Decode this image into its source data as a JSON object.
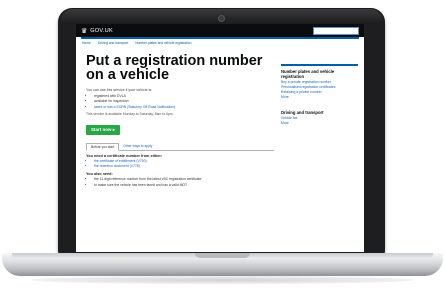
{
  "header": {
    "logo": "GOV.UK"
  },
  "breadcrumb": [
    "Home",
    "Driving and transport",
    "Number plates and vehicle registration"
  ],
  "main": {
    "title": "Put a registration number on a vehicle",
    "intro": "You can use this service if your vehicle is:",
    "bullets": [
      "registered with DVLA",
      "available for inspection",
      "taxed or has a SORN (Statutory Off Road Notification)"
    ],
    "note": "This service is available Monday to Saturday, 8am to 6pm.",
    "start_label": "Start now",
    "tabs": [
      "Before you start",
      "Other ways to apply"
    ],
    "section_heading": "You need a certificate number from either:",
    "section_links": [
      "the certificate of entitlement (V750)",
      "the retention document (V778)"
    ],
    "section2_heading": "You also need:",
    "section2_items": [
      "the 11-digit reference number from the latest V5C registration certificate",
      "to make sure the vehicle has been taxed and has a valid MOT"
    ]
  },
  "sidebar": {
    "heading1": "Number plates and vehicle registration",
    "links1": [
      "Buy a private registration number",
      "Personalised registration certificates",
      "Retaining a private number"
    ],
    "more1": "More",
    "heading2": "Driving and transport",
    "links2": [
      "Vehicle tax"
    ],
    "more2": "More"
  },
  "colors": {
    "brand_blue": "#005ea5",
    "start_green": "#28a745",
    "header_black": "#0b0c0c"
  }
}
